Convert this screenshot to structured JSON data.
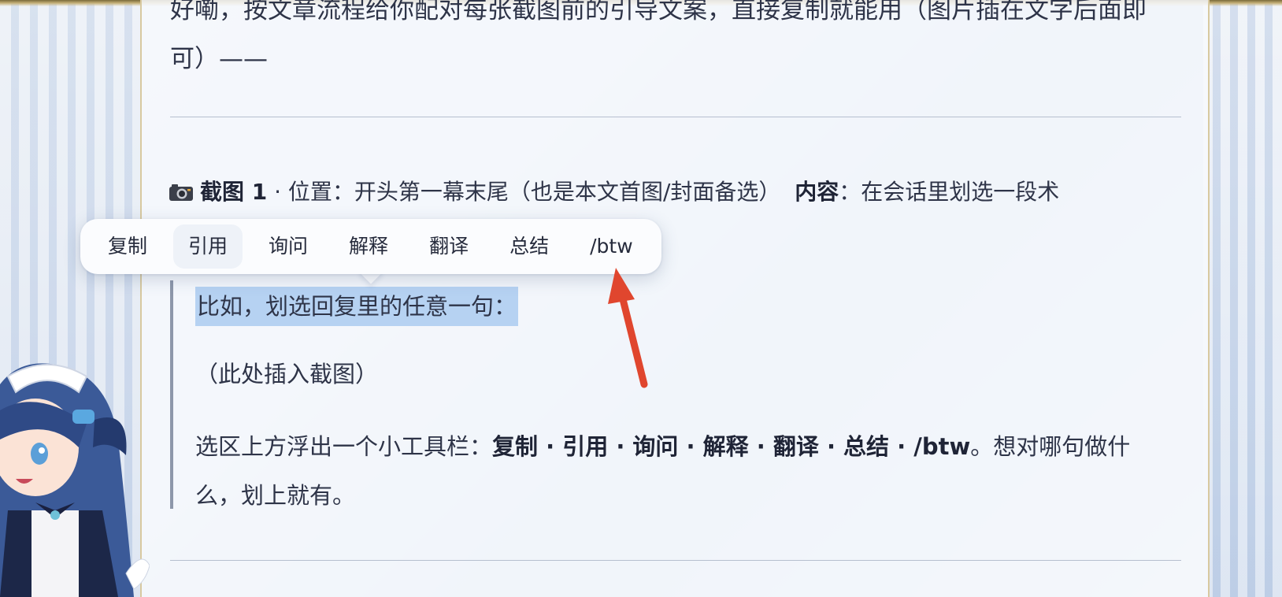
{
  "article": {
    "top_paragraph_line1": "好嘞，按文章流程给你配对每张截图前的引导文案，直接复制就能用（图片插在文字后面即",
    "top_paragraph_line2": "可）——",
    "screenshot": {
      "label": "截图 1",
      "position_prefix": " · 位置：开头第一幕末尾（也是本文首图/封面备选）",
      "content_label": "内容",
      "content_text": "：在会话里划选一段术"
    },
    "quote": {
      "selected_text": "比如，划选回复里的任意一句：",
      "placeholder": "（此处插入截图）",
      "description_prefix": "选区上方浮出一个小工具栏：",
      "toolbar_list": "复制 · 引用 · 询问 · 解释 · 翻译 · 总结 · /btw",
      "description_suffix": "。想对哪句做什",
      "description_line2": "么，划上就有。"
    }
  },
  "toolbar": {
    "items": [
      "复制",
      "引用",
      "询问",
      "解释",
      "翻译",
      "总结",
      "/btw"
    ]
  },
  "colors": {
    "selection": "#b6d2f2",
    "arrow": "#e0462e",
    "text": "#2e3448"
  },
  "icons": [
    "camera-icon",
    "annotation-arrow-icon",
    "mascot-character"
  ]
}
